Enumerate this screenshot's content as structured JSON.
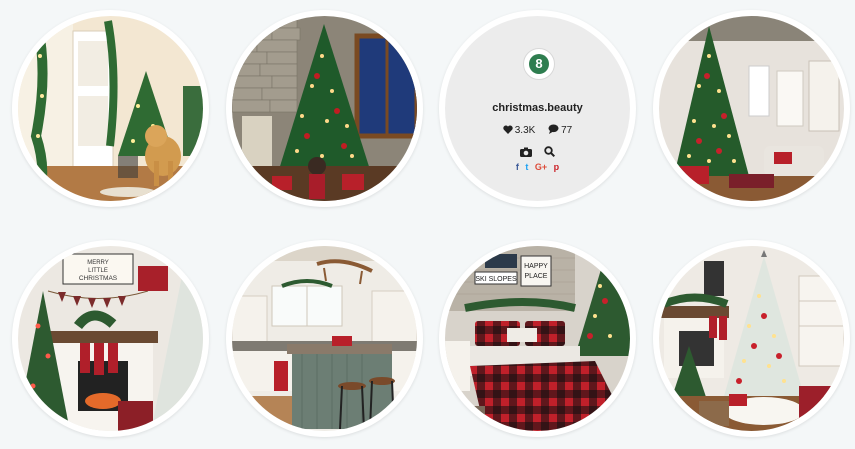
{
  "profile": {
    "avatar_text": "8",
    "username": "christmas.beauty",
    "likes": "3.3K",
    "comments": "77",
    "share": {
      "facebook": "f",
      "twitter": "t",
      "google_plus": "G+",
      "pinterest": "p"
    }
  },
  "colors": {
    "page_background": "#f4f7f8",
    "profile_background": "#ececec",
    "brand_green": "#2e7d4f",
    "facebook": "#3b5998",
    "twitter": "#1da1f2",
    "google_plus": "#dd4b39",
    "pinterest": "#cb2027"
  },
  "gallery": [
    {
      "subject": "hallway with golden retriever and christmas tree"
    },
    {
      "subject": "stone wall room with lit christmas tree and child"
    },
    {
      "subject": "profile card"
    },
    {
      "subject": "living room with tall red and white christmas tree"
    },
    {
      "subject": "fireplace mantel with stockings and flocked tree"
    },
    {
      "subject": "kitchen island with bar stools and sled"
    },
    {
      "subject": "bedroom with buffalo plaid bedding and christmas tree"
    },
    {
      "subject": "living room with white flocked christmas tree and fireplace"
    }
  ],
  "photo_signs": {
    "sign_1_line_1": "MERRY",
    "sign_1_line_2": "LITTLE",
    "sign_1_line_3": "CHRISTMAS",
    "sign_2": "SKI SLOPES",
    "sign_3_line_1": "HAPPY",
    "sign_3_line_2": "PLACE"
  },
  "icons": {
    "likes": "heart-icon",
    "comments": "speech-bubble-icon",
    "camera": "camera-icon",
    "search": "search-icon"
  }
}
